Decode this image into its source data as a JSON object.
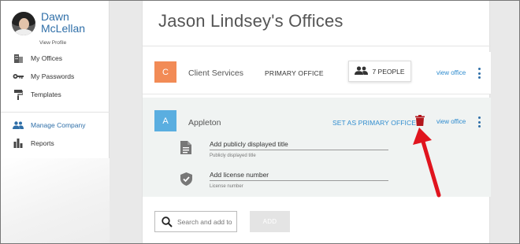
{
  "user": {
    "name": "Dawn McLellan",
    "view_profile": "View Profile"
  },
  "sidebar": {
    "items": [
      {
        "label": "My Offices",
        "icon": "building-icon",
        "active": false
      },
      {
        "label": "My Passwords",
        "icon": "key-icon",
        "active": false
      },
      {
        "label": "Templates",
        "icon": "paint-roller-icon",
        "active": false
      },
      {
        "label": "Manage Company",
        "icon": "people-icon",
        "active": true
      },
      {
        "label": "Reports",
        "icon": "bar-chart-icon",
        "active": false
      }
    ]
  },
  "main": {
    "title": "Jason Lindsey's Offices",
    "offices": [
      {
        "badge": "C",
        "badge_color": "#f28b56",
        "name": "Client Services",
        "primary_label": "PRIMARY OFFICE",
        "people_label": "7 PEOPLE",
        "view_office": "view office"
      },
      {
        "badge": "A",
        "badge_color": "#5aaee0",
        "name": "Appleton",
        "set_primary_label": "SET AS PRIMARY OFFICE",
        "view_office": "view office",
        "fields": [
          {
            "value": "Add publicly displayed title",
            "hint": "Publicly displayed title",
            "icon": "document-icon"
          },
          {
            "value": "Add license number",
            "hint": "License number",
            "icon": "shield-check-icon"
          }
        ]
      }
    ],
    "search": {
      "placeholder": "Search and add to..."
    },
    "add_label": "ADD"
  },
  "colors": {
    "accent": "#2f6fa8",
    "link": "#2f8ccf",
    "trash": "#b3161c",
    "annotation_arrow": "#e0141e"
  }
}
